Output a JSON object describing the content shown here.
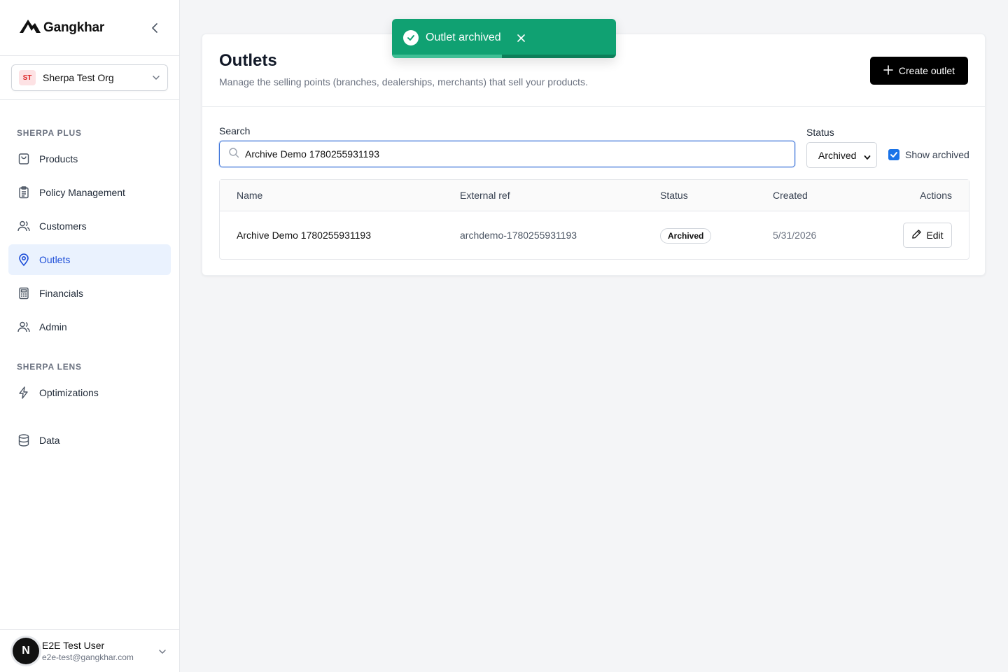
{
  "brand": {
    "name": "Gangkhar",
    "logo_icon": "mountain-logo-icon"
  },
  "org": {
    "initials": "ST",
    "name": "Sherpa Test Org"
  },
  "sidebar": {
    "section_plus": "SHERPA PLUS",
    "section_lens": "SHERPA LENS",
    "items_plus": [
      {
        "label": "Products",
        "icon": "shopping-bag-icon"
      },
      {
        "label": "Policy Management",
        "icon": "clipboard-icon"
      },
      {
        "label": "Customers",
        "icon": "users-icon"
      },
      {
        "label": "Outlets",
        "icon": "map-pin-icon",
        "active": true
      },
      {
        "label": "Financials",
        "icon": "calculator-icon"
      },
      {
        "label": "Admin",
        "icon": "users-icon"
      }
    ],
    "items_lens": [
      {
        "label": "Optimizations",
        "icon": "zap-icon"
      }
    ],
    "items_other": [
      {
        "label": "Data",
        "icon": "database-icon"
      }
    ]
  },
  "user": {
    "initial": "N",
    "name": "E2E Test User",
    "email": "e2e-test@gangkhar.com"
  },
  "page": {
    "title": "Outlets",
    "subtitle": "Manage the selling points (branches, dealerships, merchants) that sell your products.",
    "create_label": "Create outlet"
  },
  "filters": {
    "search_label": "Search",
    "search_value": "Archive Demo 1780255931193",
    "status_label": "Status",
    "status_value": "Archived",
    "show_archived_label": "Show archived",
    "show_archived_checked": true
  },
  "table": {
    "headers": [
      "Name",
      "External ref",
      "Status",
      "Created",
      "Actions"
    ],
    "rows": [
      {
        "name": "Archive Demo 1780255931193",
        "external_ref": "archdemo-1780255931193",
        "status": "Archived",
        "created": "5/31/2026",
        "action": "Edit"
      }
    ]
  },
  "toast": {
    "message": "Outlet archived",
    "progress": 0.49,
    "color": "#10a172"
  },
  "colors": {
    "accent": "#1d4ed8",
    "active_bg": "#eaf2fe",
    "success": "#10a172"
  }
}
